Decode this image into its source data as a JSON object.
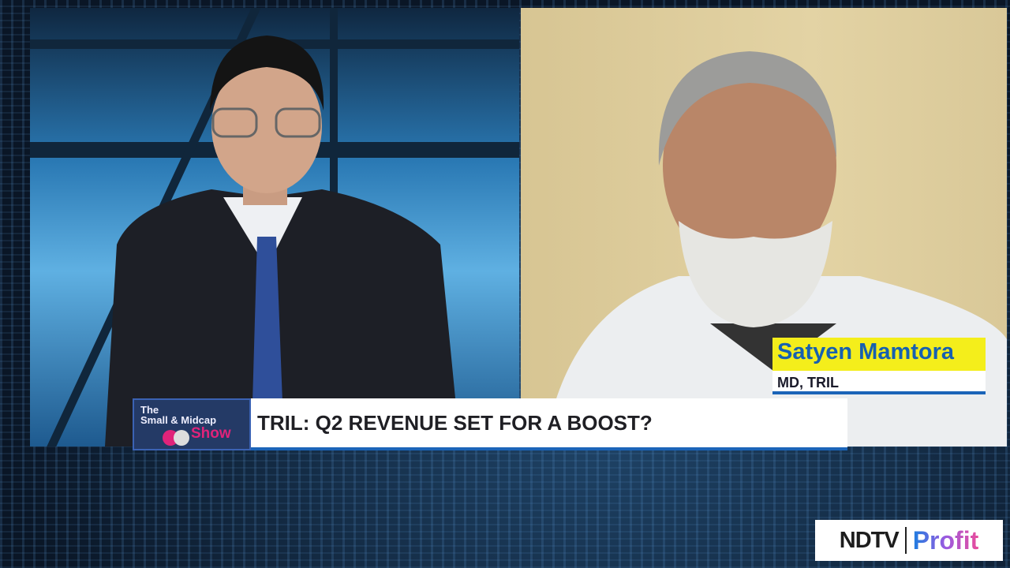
{
  "show": {
    "line1": "The",
    "line2": "Small & Midcap",
    "line3": "Show"
  },
  "headline": "TRIL: Q2 REVENUE SET FOR A BOOST?",
  "guest": {
    "name": "Satyen Mamtora",
    "title": "MD, TRIL"
  },
  "brand": {
    "ndtv": "NDTV",
    "profit": "Profit"
  },
  "colors": {
    "name_bg": "#f4ee1b",
    "name_text": "#1760b0",
    "accent": "#1b64b8",
    "show_pink": "#e0237a"
  }
}
